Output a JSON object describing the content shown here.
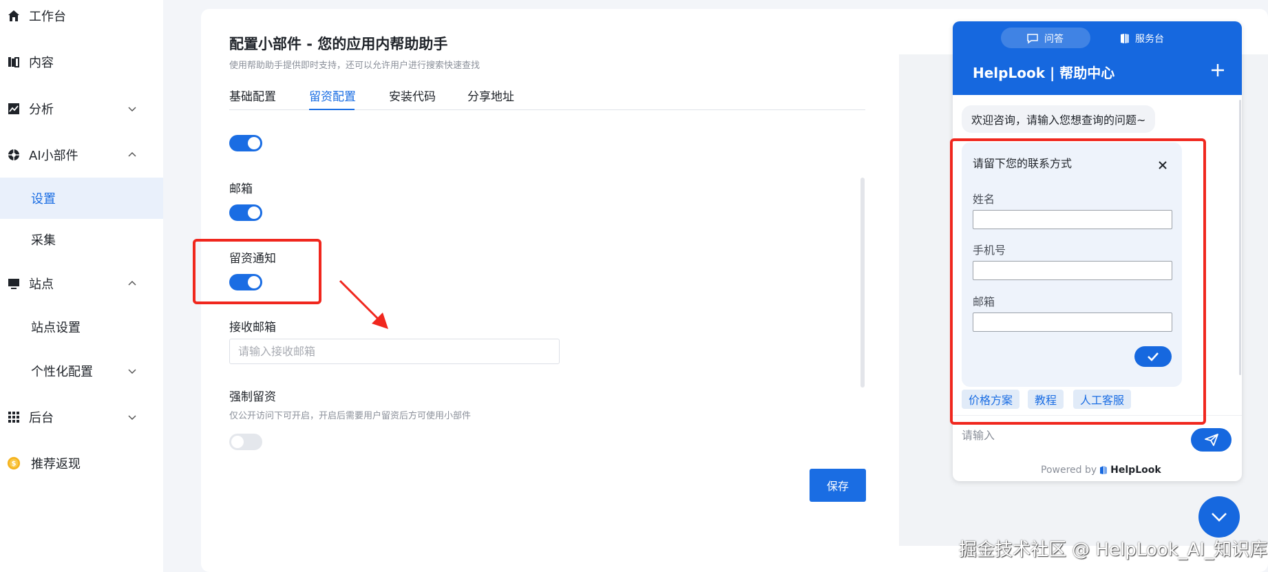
{
  "sidebar": {
    "items": [
      {
        "label": "工作台",
        "icon": "home-icon"
      },
      {
        "label": "内容",
        "icon": "library-icon"
      },
      {
        "label": "分析",
        "icon": "chart-icon"
      },
      {
        "label": "AI小部件",
        "icon": "aperture-icon"
      },
      {
        "label": "设置"
      },
      {
        "label": "采集"
      },
      {
        "label": "站点",
        "icon": "monitor-icon"
      },
      {
        "label": "站点设置"
      },
      {
        "label": "个性化配置"
      },
      {
        "label": "后台",
        "icon": "grid-icon"
      },
      {
        "label": "推荐返现",
        "icon": "coin-icon"
      }
    ]
  },
  "main": {
    "title": "配置小部件 - 您的应用内帮助助手",
    "subtitle": "使用帮助助手提供即时支持，还可以允许用户进行搜索快速查找",
    "tabs": [
      "基础配置",
      "留资配置",
      "安装代码",
      "分享地址"
    ],
    "active_tab": "留资配置",
    "fields": {
      "email_label": "邮箱",
      "notify_label": "留资通知",
      "receive_email_label": "接收邮箱",
      "receive_email_placeholder": "请输入接收邮箱",
      "force_label": "强制留资",
      "force_hint": "仅公开访问下可开启，开启后需要用户留资后方可使用小部件"
    },
    "toggles": {
      "first": true,
      "email": true,
      "notify": true,
      "force": false
    },
    "save_label": "保存"
  },
  "widget": {
    "tabs": [
      "问答",
      "服务台"
    ],
    "title": "HelpLook | 帮助中心",
    "welcome": "欢迎咨询，请输入您想查询的问题~",
    "form": {
      "title": "请留下您的联系方式",
      "name_label": "姓名",
      "phone_label": "手机号",
      "email_label": "邮箱"
    },
    "chips": [
      "价格方案",
      "教程",
      "人工客服"
    ],
    "input_placeholder": "请输入",
    "powered_by": "Powered by",
    "brand": "HelpLook"
  },
  "watermark": "掘金技术社区 @ HelpLook_AI_知识库",
  "colors": {
    "accent": "#1a6de3",
    "highlight": "#f0271e"
  }
}
